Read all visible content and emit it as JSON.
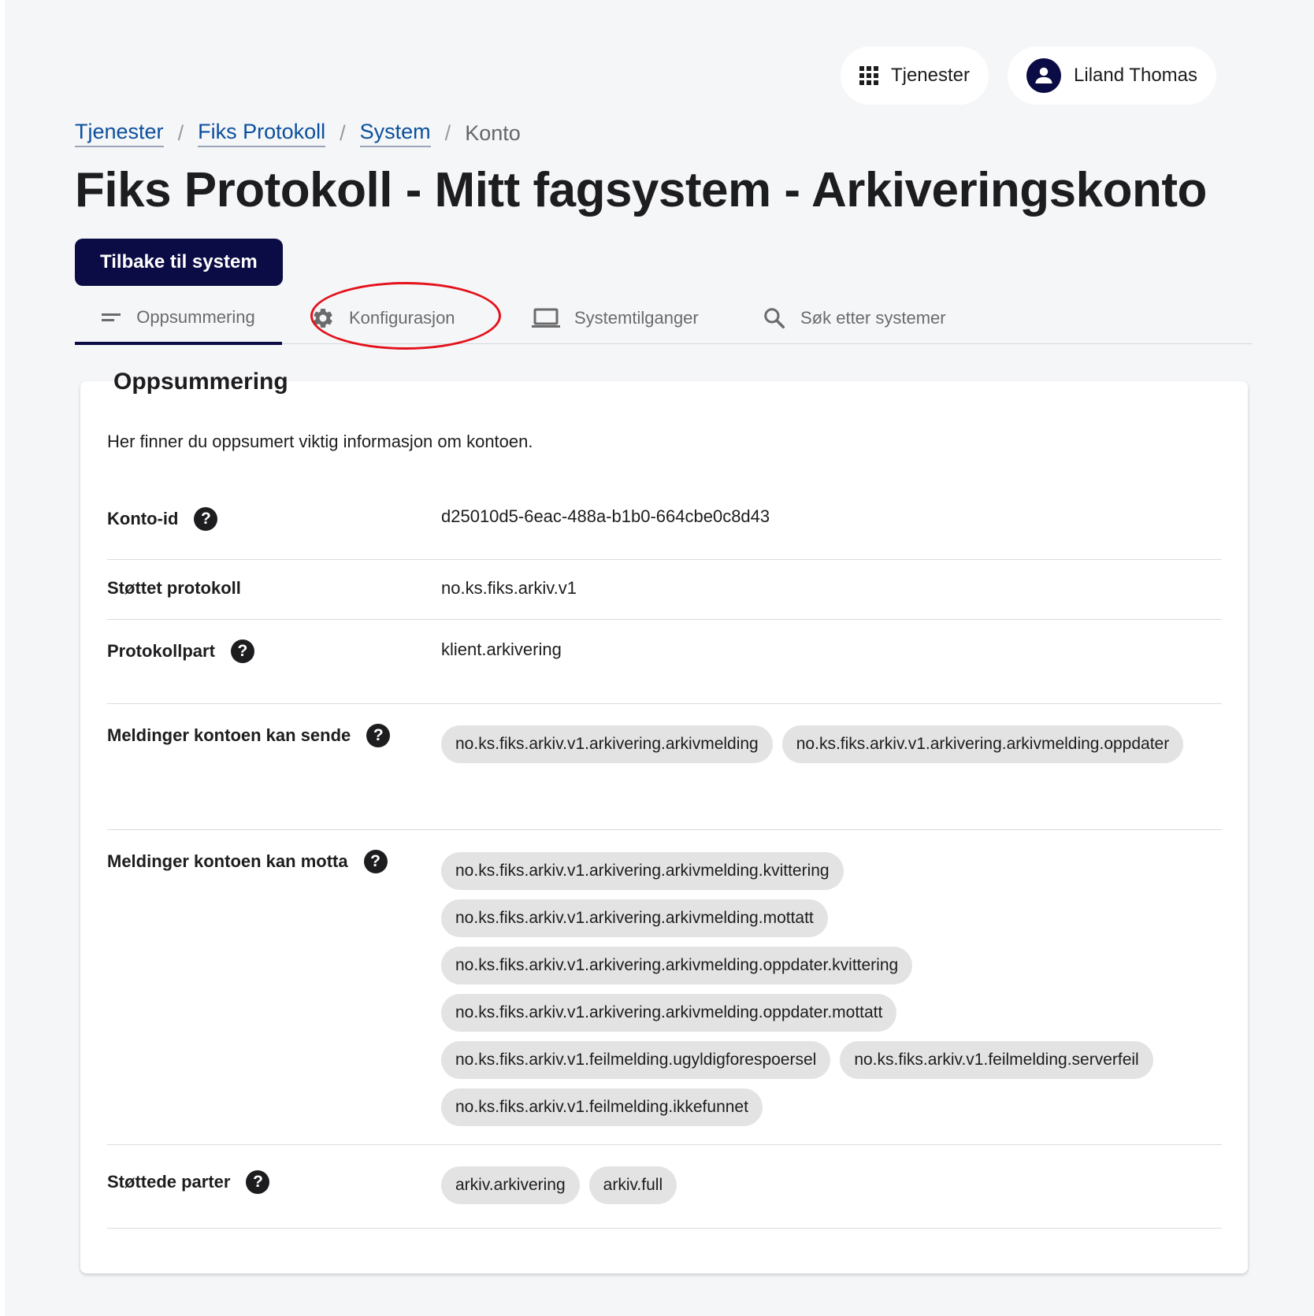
{
  "header": {
    "services_label": "Tjenester",
    "user_name": "Liland Thomas"
  },
  "breadcrumb": {
    "items": [
      "Tjenester",
      "Fiks Protokoll",
      "System"
    ],
    "current": "Konto"
  },
  "page_title": "Fiks Protokoll - Mitt fagsystem - Arkiveringskonto",
  "back_button": "Tilbake til system",
  "tabs": [
    {
      "label": "Oppsummering",
      "icon": "short-text-icon",
      "active": true
    },
    {
      "label": "Konfigurasjon",
      "icon": "gear-icon",
      "active": false
    },
    {
      "label": "Systemtilganger",
      "icon": "laptop-icon",
      "active": false
    },
    {
      "label": "Søk etter systemer",
      "icon": "search-icon",
      "active": false
    }
  ],
  "summary": {
    "title": "Oppsummering",
    "intro": "Her finner du oppsumert viktig informasjon om kontoen.",
    "konto_id": {
      "label": "Konto-id",
      "value": "d25010d5-6eac-488a-b1b0-664cbe0c8d43"
    },
    "protokoll": {
      "label": "Støttet protokoll",
      "value": "no.ks.fiks.arkiv.v1"
    },
    "protokollpart": {
      "label": "Protokollpart",
      "value": "klient.arkivering"
    },
    "sende": {
      "label": "Meldinger kontoen kan sende",
      "chips": [
        "no.ks.fiks.arkiv.v1.arkivering.arkivmelding",
        "no.ks.fiks.arkiv.v1.arkivering.arkivmelding.oppdater"
      ]
    },
    "motta": {
      "label": "Meldinger kontoen kan motta",
      "chips": [
        "no.ks.fiks.arkiv.v1.arkivering.arkivmelding.kvittering",
        "no.ks.fiks.arkiv.v1.arkivering.arkivmelding.mottatt",
        "no.ks.fiks.arkiv.v1.arkivering.arkivmelding.oppdater.kvittering",
        "no.ks.fiks.arkiv.v1.arkivering.arkivmelding.oppdater.mottatt",
        "no.ks.fiks.arkiv.v1.feilmelding.ugyldigforespoersel",
        "no.ks.fiks.arkiv.v1.feilmelding.serverfeil",
        "no.ks.fiks.arkiv.v1.feilmelding.ikkefunnet"
      ]
    },
    "parter": {
      "label": "Støttede parter",
      "chips": [
        "arkiv.arkivering",
        "arkiv.full"
      ]
    }
  },
  "colors": {
    "primary": "#0b0b45",
    "link": "#0b4f9c",
    "highlight": "#e3121b"
  }
}
